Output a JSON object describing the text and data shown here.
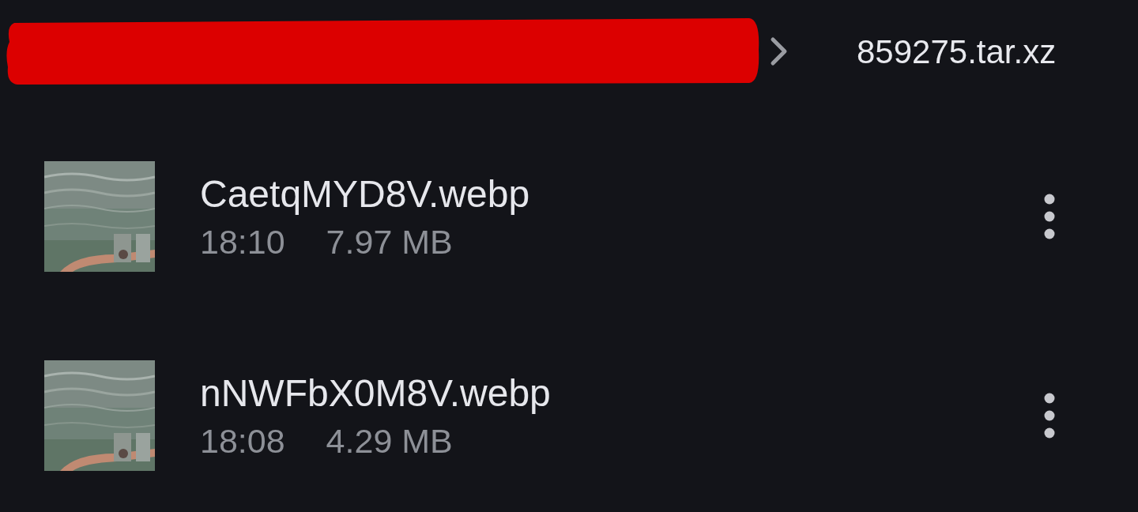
{
  "breadcrumb": {
    "current": "859275.tar.xz"
  },
  "files": [
    {
      "name": "CaetqMYD8V.webp",
      "time": "18:10",
      "size": "7.97 MB"
    },
    {
      "name": "nNWFbX0M8V.webp",
      "time": "18:08",
      "size": "4.29 MB"
    }
  ]
}
